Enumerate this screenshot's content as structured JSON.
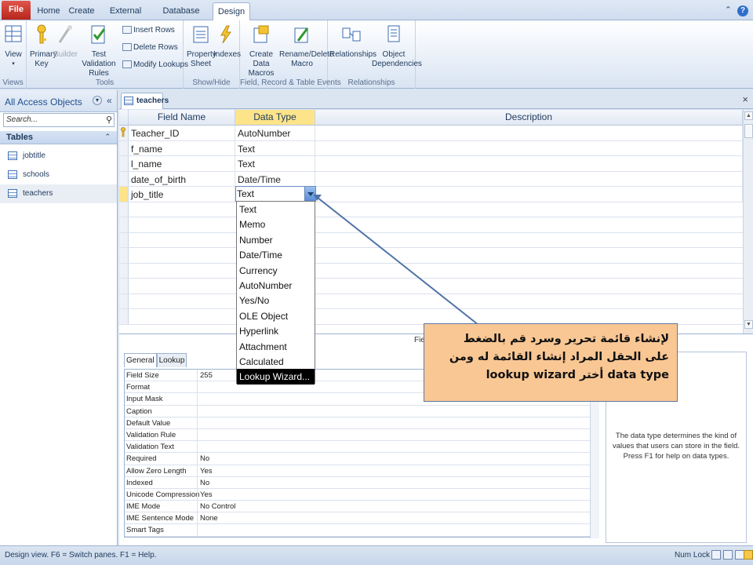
{
  "ribbon_tabs": [
    "File",
    "Home",
    "Create",
    "External Data",
    "Database Tools",
    "Design"
  ],
  "ribbon": {
    "view": "View",
    "views_group": "Views",
    "primary_key": "Primary Key",
    "builder": "Builder",
    "test_validation": "Test Validation Rules",
    "insert_rows": "Insert Rows",
    "delete_rows": "Delete Rows",
    "modify_lookups": "Modify Lookups",
    "tools_group": "Tools",
    "property_sheet": "Property Sheet",
    "indexes": "Indexes",
    "showhide_group": "Show/Hide",
    "create_data_macros": "Create Data Macros",
    "rename_delete_macro": "Rename/Delete Macro",
    "field_group": "Field, Record & Table Events",
    "relationships": "Relationships",
    "object_dependencies": "Object Dependencies",
    "relationships_group": "Relationships"
  },
  "nav": {
    "title": "All Access Objects",
    "search_placeholder": "Search...",
    "section": "Tables",
    "items": [
      "jobtitle",
      "schools",
      "teachers"
    ]
  },
  "document": {
    "tab": "teachers",
    "headers": [
      "Field Name",
      "Data Type",
      "Description"
    ],
    "rows": [
      {
        "name": "Teacher_ID",
        "type": "AutoNumber"
      },
      {
        "name": "f_name",
        "type": "Text"
      },
      {
        "name": "l_name",
        "type": "Text"
      },
      {
        "name": "date_of_birth",
        "type": "Date/Time"
      },
      {
        "name": "job_title",
        "type": "Text"
      }
    ]
  },
  "dropdown": {
    "selected": "Text",
    "options": [
      "Text",
      "Memo",
      "Number",
      "Date/Time",
      "Currency",
      "AutoNumber",
      "Yes/No",
      "OLE Object",
      "Hyperlink",
      "Attachment",
      "Calculated",
      "Lookup Wizard..."
    ]
  },
  "properties": {
    "caption": "Fiel",
    "tabs": [
      "General",
      "Lookup"
    ],
    "rows": [
      {
        "k": "Field Size",
        "v": "255"
      },
      {
        "k": "Format",
        "v": ""
      },
      {
        "k": "Input Mask",
        "v": ""
      },
      {
        "k": "Caption",
        "v": ""
      },
      {
        "k": "Default Value",
        "v": ""
      },
      {
        "k": "Validation Rule",
        "v": ""
      },
      {
        "k": "Validation Text",
        "v": ""
      },
      {
        "k": "Required",
        "v": "No"
      },
      {
        "k": "Allow Zero Length",
        "v": "Yes"
      },
      {
        "k": "Indexed",
        "v": "No"
      },
      {
        "k": "Unicode Compression",
        "v": "Yes"
      },
      {
        "k": "IME Mode",
        "v": "No Control"
      },
      {
        "k": "IME Sentence Mode",
        "v": "None"
      },
      {
        "k": "Smart Tags",
        "v": ""
      }
    ],
    "help": "The data type determines the kind of values that users can store in the field. Press F1 for help on data types."
  },
  "callout": {
    "line1": "لإنشاء قائمة تحرير وسرد قم بالضغط",
    "line2": "على الحقل المراد إنشاء القائمة له ومن",
    "line3": "data type أختر lookup wizard"
  },
  "status": {
    "text": "Design view.  F6 = Switch panes.  F1 = Help.",
    "numlock": "Num Lock"
  }
}
